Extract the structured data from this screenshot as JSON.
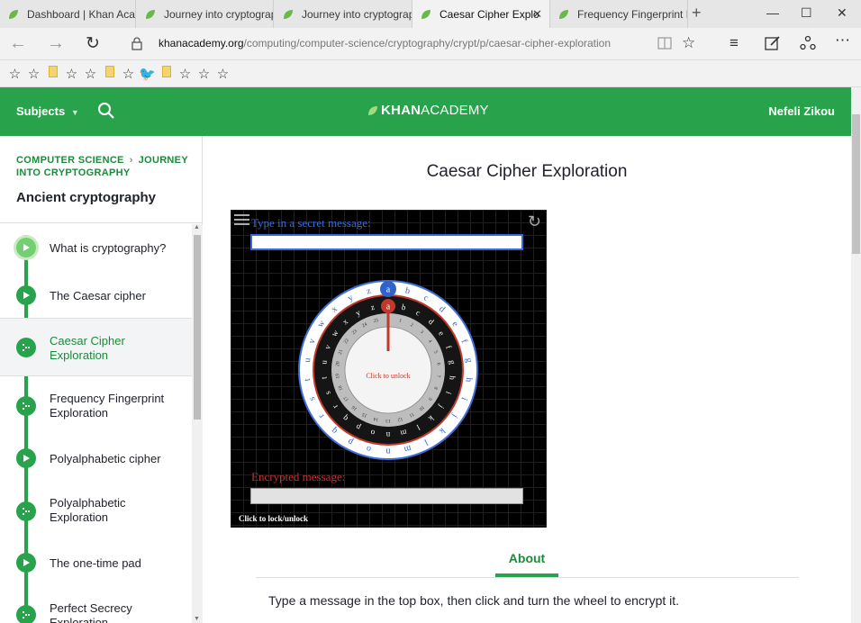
{
  "browser": {
    "tabs": [
      {
        "title": "Dashboard | Khan Acad",
        "active": false
      },
      {
        "title": "Journey into cryptograp",
        "active": false
      },
      {
        "title": "Journey into cryptograp",
        "active": false
      },
      {
        "title": "Caesar Cipher Explo",
        "active": true
      },
      {
        "title": "Frequency Fingerprint E",
        "active": false
      }
    ],
    "url_host": "khanacademy.org",
    "url_path": "/computing/computer-science/cryptography/crypt/p/caesar-cipher-exploration"
  },
  "header": {
    "subjects_label": "Subjects",
    "logo_bold": "KHAN",
    "logo_rest": "ACADEMY",
    "user_name": "Nefeli Zikou",
    "brand_color": "#29a34b"
  },
  "sidebar": {
    "breadcrumb_1": "COMPUTER SCIENCE",
    "breadcrumb_2": "JOURNEY INTO CRYPTOGRAPHY",
    "section_title": "Ancient cryptography",
    "items": [
      {
        "label": "What is cryptography?",
        "type": "video",
        "selected": false
      },
      {
        "label": "The Caesar cipher",
        "type": "video",
        "selected": false
      },
      {
        "label": "Caesar Cipher Exploration",
        "type": "exploration",
        "selected": true
      },
      {
        "label": "Frequency Fingerprint Exploration",
        "type": "exploration",
        "selected": false
      },
      {
        "label": "Polyalphabetic cipher",
        "type": "video",
        "selected": false
      },
      {
        "label": "Polyalphabetic Exploration",
        "type": "exploration",
        "selected": false
      },
      {
        "label": "The one-time pad",
        "type": "video",
        "selected": false
      },
      {
        "label": "Perfect Secrecy Exploration",
        "type": "exploration",
        "selected": false
      }
    ]
  },
  "main": {
    "title": "Caesar Cipher Exploration",
    "widget": {
      "input_label": "Type in a secret message:",
      "output_label": "Encrypted message:",
      "lock_hint": "Click to lock/unlock",
      "center_text": "Click to unlock",
      "outer_top_letter": "a",
      "inner_top_letter": "a",
      "outer_ring": [
        "a",
        "b",
        "c",
        "d",
        "e",
        "f",
        "g",
        "h",
        "i",
        "j",
        "k",
        "l",
        "m",
        "n",
        "o",
        "p",
        "q",
        "r",
        "s",
        "t",
        "u",
        "v",
        "w",
        "x",
        "y",
        "z"
      ],
      "inner_ring": [
        "a",
        "b",
        "c",
        "d",
        "e",
        "f",
        "g",
        "h",
        "i",
        "j",
        "k",
        "l",
        "m",
        "n",
        "o",
        "p",
        "q",
        "r",
        "s",
        "t",
        "u",
        "v",
        "w",
        "x",
        "y",
        "z"
      ],
      "numbers": [
        "0",
        "1",
        "2",
        "3",
        "4",
        "5",
        "6",
        "7",
        "8",
        "9",
        "10",
        "11",
        "12",
        "13",
        "14",
        "15",
        "16",
        "17",
        "18",
        "19",
        "20",
        "21",
        "22",
        "23",
        "24",
        "25"
      ]
    },
    "about_tab": "About",
    "description": "Type a message in the top box, then click and turn the wheel to encrypt it."
  }
}
